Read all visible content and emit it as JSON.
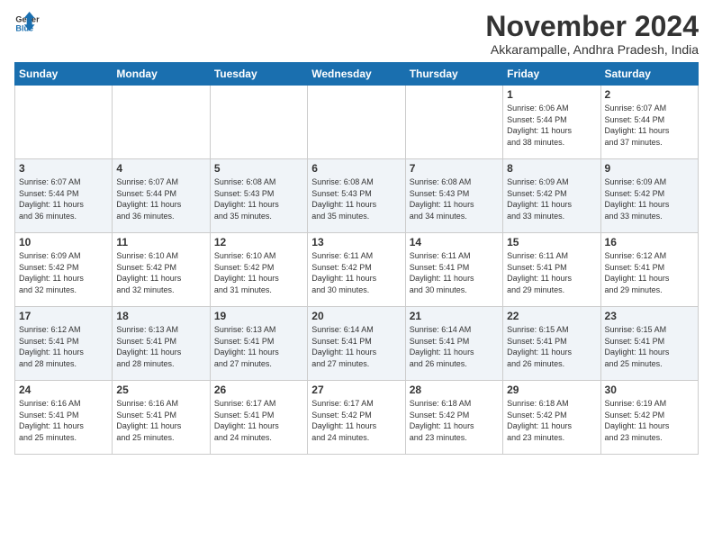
{
  "logo": {
    "line1": "General",
    "line2": "Blue"
  },
  "title": "November 2024",
  "location": "Akkarampalle, Andhra Pradesh, India",
  "days_header": [
    "Sunday",
    "Monday",
    "Tuesday",
    "Wednesday",
    "Thursday",
    "Friday",
    "Saturday"
  ],
  "weeks": [
    [
      {
        "day": "",
        "info": ""
      },
      {
        "day": "",
        "info": ""
      },
      {
        "day": "",
        "info": ""
      },
      {
        "day": "",
        "info": ""
      },
      {
        "day": "",
        "info": ""
      },
      {
        "day": "1",
        "info": "Sunrise: 6:06 AM\nSunset: 5:44 PM\nDaylight: 11 hours\nand 38 minutes."
      },
      {
        "day": "2",
        "info": "Sunrise: 6:07 AM\nSunset: 5:44 PM\nDaylight: 11 hours\nand 37 minutes."
      }
    ],
    [
      {
        "day": "3",
        "info": "Sunrise: 6:07 AM\nSunset: 5:44 PM\nDaylight: 11 hours\nand 36 minutes."
      },
      {
        "day": "4",
        "info": "Sunrise: 6:07 AM\nSunset: 5:44 PM\nDaylight: 11 hours\nand 36 minutes."
      },
      {
        "day": "5",
        "info": "Sunrise: 6:08 AM\nSunset: 5:43 PM\nDaylight: 11 hours\nand 35 minutes."
      },
      {
        "day": "6",
        "info": "Sunrise: 6:08 AM\nSunset: 5:43 PM\nDaylight: 11 hours\nand 35 minutes."
      },
      {
        "day": "7",
        "info": "Sunrise: 6:08 AM\nSunset: 5:43 PM\nDaylight: 11 hours\nand 34 minutes."
      },
      {
        "day": "8",
        "info": "Sunrise: 6:09 AM\nSunset: 5:42 PM\nDaylight: 11 hours\nand 33 minutes."
      },
      {
        "day": "9",
        "info": "Sunrise: 6:09 AM\nSunset: 5:42 PM\nDaylight: 11 hours\nand 33 minutes."
      }
    ],
    [
      {
        "day": "10",
        "info": "Sunrise: 6:09 AM\nSunset: 5:42 PM\nDaylight: 11 hours\nand 32 minutes."
      },
      {
        "day": "11",
        "info": "Sunrise: 6:10 AM\nSunset: 5:42 PM\nDaylight: 11 hours\nand 32 minutes."
      },
      {
        "day": "12",
        "info": "Sunrise: 6:10 AM\nSunset: 5:42 PM\nDaylight: 11 hours\nand 31 minutes."
      },
      {
        "day": "13",
        "info": "Sunrise: 6:11 AM\nSunset: 5:42 PM\nDaylight: 11 hours\nand 30 minutes."
      },
      {
        "day": "14",
        "info": "Sunrise: 6:11 AM\nSunset: 5:41 PM\nDaylight: 11 hours\nand 30 minutes."
      },
      {
        "day": "15",
        "info": "Sunrise: 6:11 AM\nSunset: 5:41 PM\nDaylight: 11 hours\nand 29 minutes."
      },
      {
        "day": "16",
        "info": "Sunrise: 6:12 AM\nSunset: 5:41 PM\nDaylight: 11 hours\nand 29 minutes."
      }
    ],
    [
      {
        "day": "17",
        "info": "Sunrise: 6:12 AM\nSunset: 5:41 PM\nDaylight: 11 hours\nand 28 minutes."
      },
      {
        "day": "18",
        "info": "Sunrise: 6:13 AM\nSunset: 5:41 PM\nDaylight: 11 hours\nand 28 minutes."
      },
      {
        "day": "19",
        "info": "Sunrise: 6:13 AM\nSunset: 5:41 PM\nDaylight: 11 hours\nand 27 minutes."
      },
      {
        "day": "20",
        "info": "Sunrise: 6:14 AM\nSunset: 5:41 PM\nDaylight: 11 hours\nand 27 minutes."
      },
      {
        "day": "21",
        "info": "Sunrise: 6:14 AM\nSunset: 5:41 PM\nDaylight: 11 hours\nand 26 minutes."
      },
      {
        "day": "22",
        "info": "Sunrise: 6:15 AM\nSunset: 5:41 PM\nDaylight: 11 hours\nand 26 minutes."
      },
      {
        "day": "23",
        "info": "Sunrise: 6:15 AM\nSunset: 5:41 PM\nDaylight: 11 hours\nand 25 minutes."
      }
    ],
    [
      {
        "day": "24",
        "info": "Sunrise: 6:16 AM\nSunset: 5:41 PM\nDaylight: 11 hours\nand 25 minutes."
      },
      {
        "day": "25",
        "info": "Sunrise: 6:16 AM\nSunset: 5:41 PM\nDaylight: 11 hours\nand 25 minutes."
      },
      {
        "day": "26",
        "info": "Sunrise: 6:17 AM\nSunset: 5:41 PM\nDaylight: 11 hours\nand 24 minutes."
      },
      {
        "day": "27",
        "info": "Sunrise: 6:17 AM\nSunset: 5:42 PM\nDaylight: 11 hours\nand 24 minutes."
      },
      {
        "day": "28",
        "info": "Sunrise: 6:18 AM\nSunset: 5:42 PM\nDaylight: 11 hours\nand 23 minutes."
      },
      {
        "day": "29",
        "info": "Sunrise: 6:18 AM\nSunset: 5:42 PM\nDaylight: 11 hours\nand 23 minutes."
      },
      {
        "day": "30",
        "info": "Sunrise: 6:19 AM\nSunset: 5:42 PM\nDaylight: 11 hours\nand 23 minutes."
      }
    ]
  ]
}
